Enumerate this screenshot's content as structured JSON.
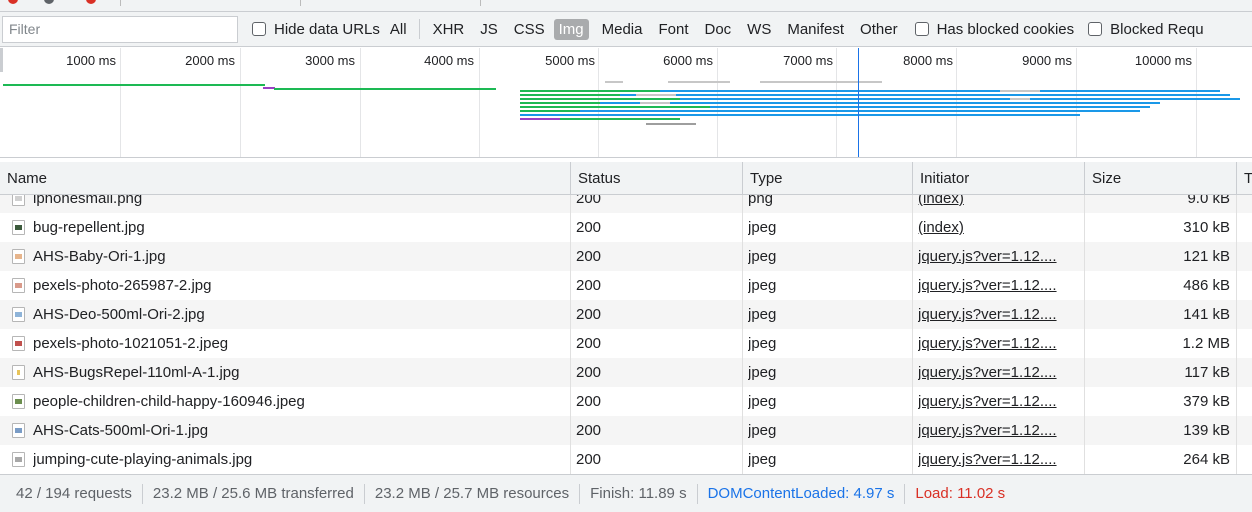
{
  "filter": {
    "placeholder": "Filter",
    "hide_data_urls_label": "Hide data URLs",
    "types": [
      "All",
      "XHR",
      "JS",
      "CSS",
      "Img",
      "Media",
      "Font",
      "Doc",
      "WS",
      "Manifest",
      "Other"
    ],
    "active_type": "Img",
    "has_blocked_cookies_label": "Has blocked cookies",
    "blocked_requests_label": "Blocked Requ"
  },
  "overview": {
    "ticks": [
      "1000 ms",
      "2000 ms",
      "3000 ms",
      "4000 ms",
      "5000 ms",
      "6000 ms",
      "7000 ms",
      "8000 ms",
      "9000 ms",
      "10000 ms"
    ],
    "colors": {
      "marker": "#1a73e8",
      "green": "#1db954",
      "blue": "#1a98e8",
      "purple": "#9b3fc4",
      "gray": "#c7c7c7"
    }
  },
  "table": {
    "columns": [
      "Name",
      "Status",
      "Type",
      "Initiator",
      "Size",
      "T"
    ],
    "rows": [
      {
        "name": "iphonesmall.png",
        "status": "200",
        "type": "png",
        "initiator": "(index)",
        "size": "9.0 kB",
        "icon": "image-file-icon"
      },
      {
        "name": "bug-repellent.jpg",
        "status": "200",
        "type": "jpeg",
        "initiator": "(index)",
        "size": "310 kB",
        "icon": "image-file-icon"
      },
      {
        "name": "AHS-Baby-Ori-1.jpg",
        "status": "200",
        "type": "jpeg",
        "initiator": "jquery.js?ver=1.12....",
        "size": "121 kB",
        "icon": "image-file-icon"
      },
      {
        "name": "pexels-photo-265987-2.jpg",
        "status": "200",
        "type": "jpeg",
        "initiator": "jquery.js?ver=1.12....",
        "size": "486 kB",
        "icon": "image-file-icon"
      },
      {
        "name": "AHS-Deo-500ml-Ori-2.jpg",
        "status": "200",
        "type": "jpeg",
        "initiator": "jquery.js?ver=1.12....",
        "size": "141 kB",
        "icon": "image-file-icon"
      },
      {
        "name": "pexels-photo-1021051-2.jpeg",
        "status": "200",
        "type": "jpeg",
        "initiator": "jquery.js?ver=1.12....",
        "size": "1.2 MB",
        "icon": "image-file-icon"
      },
      {
        "name": "AHS-BugsRepel-110ml-A-1.jpg",
        "status": "200",
        "type": "jpeg",
        "initiator": "jquery.js?ver=1.12....",
        "size": "117 kB",
        "icon": "image-file-icon"
      },
      {
        "name": "people-children-child-happy-160946.jpeg",
        "status": "200",
        "type": "jpeg",
        "initiator": "jquery.js?ver=1.12....",
        "size": "379 kB",
        "icon": "image-file-icon"
      },
      {
        "name": "AHS-Cats-500ml-Ori-1.jpg",
        "status": "200",
        "type": "jpeg",
        "initiator": "jquery.js?ver=1.12....",
        "size": "139 kB",
        "icon": "image-file-icon"
      },
      {
        "name": "jumping-cute-playing-animals.jpg",
        "status": "200",
        "type": "jpeg",
        "initiator": "jquery.js?ver=1.12....",
        "size": "264 kB",
        "icon": "image-file-icon"
      }
    ]
  },
  "statusbar": {
    "requests": "42 / 194 requests",
    "transferred": "23.2 MB / 25.6 MB transferred",
    "resources": "23.2 MB / 25.7 MB resources",
    "finish": "Finish: 11.89 s",
    "dom_content_loaded": "DOMContentLoaded: 4.97 s",
    "load": "Load: 11.02 s",
    "dcl_color": "#1a73e8",
    "load_color": "#d93025"
  }
}
